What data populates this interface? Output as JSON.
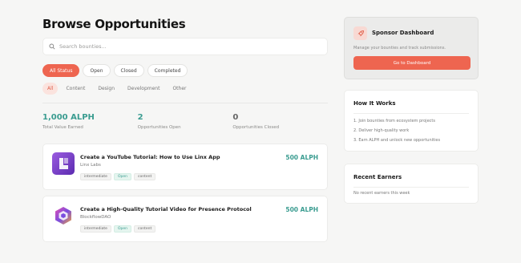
{
  "page": {
    "title": "Browse Opportunities"
  },
  "search": {
    "placeholder": "Search bounties..."
  },
  "status_filters": [
    {
      "label": "All Status",
      "active": true
    },
    {
      "label": "Open",
      "active": false
    },
    {
      "label": "Closed",
      "active": false
    },
    {
      "label": "Completed",
      "active": false
    }
  ],
  "category_filters": [
    {
      "label": "All",
      "active": true
    },
    {
      "label": "Content",
      "active": false
    },
    {
      "label": "Design",
      "active": false
    },
    {
      "label": "Development",
      "active": false
    },
    {
      "label": "Other",
      "active": false
    }
  ],
  "stats": [
    {
      "value": "1,000 ALPH",
      "label": "Total Value Earned"
    },
    {
      "value": "2",
      "label": "Opportunities Open"
    },
    {
      "value": "0",
      "label": "Opportunities Closed"
    }
  ],
  "bounties": [
    {
      "title": "Create a YouTube Tutorial: How to Use Linx App",
      "org": "Linx Labs",
      "reward": "500 ALPH",
      "tags": [
        "intermediate",
        "Open",
        "content"
      ]
    },
    {
      "title": "Create a High-Quality Tutorial Video for Presence Protocol",
      "org": "BlockflowDAO",
      "reward": "500 ALPH",
      "tags": [
        "intermediate",
        "Open",
        "content"
      ]
    }
  ],
  "sponsor": {
    "title": "Sponsor Dashboard",
    "description": "Manage your bounties and track submissions.",
    "button": "Go to Dashboard"
  },
  "how_it_works": {
    "title": "How It Works",
    "steps": [
      "1. Join bounties from ecosystem projects",
      "2. Deliver high-quality work",
      "3. Earn ALPH and unlock new opportunities"
    ]
  },
  "recent_earners": {
    "title": "Recent Earners",
    "empty_text": "No recent earners this week"
  },
  "colors": {
    "accent": "#ee6550",
    "teal": "#3a9c90",
    "background": "#f6f6f5"
  }
}
